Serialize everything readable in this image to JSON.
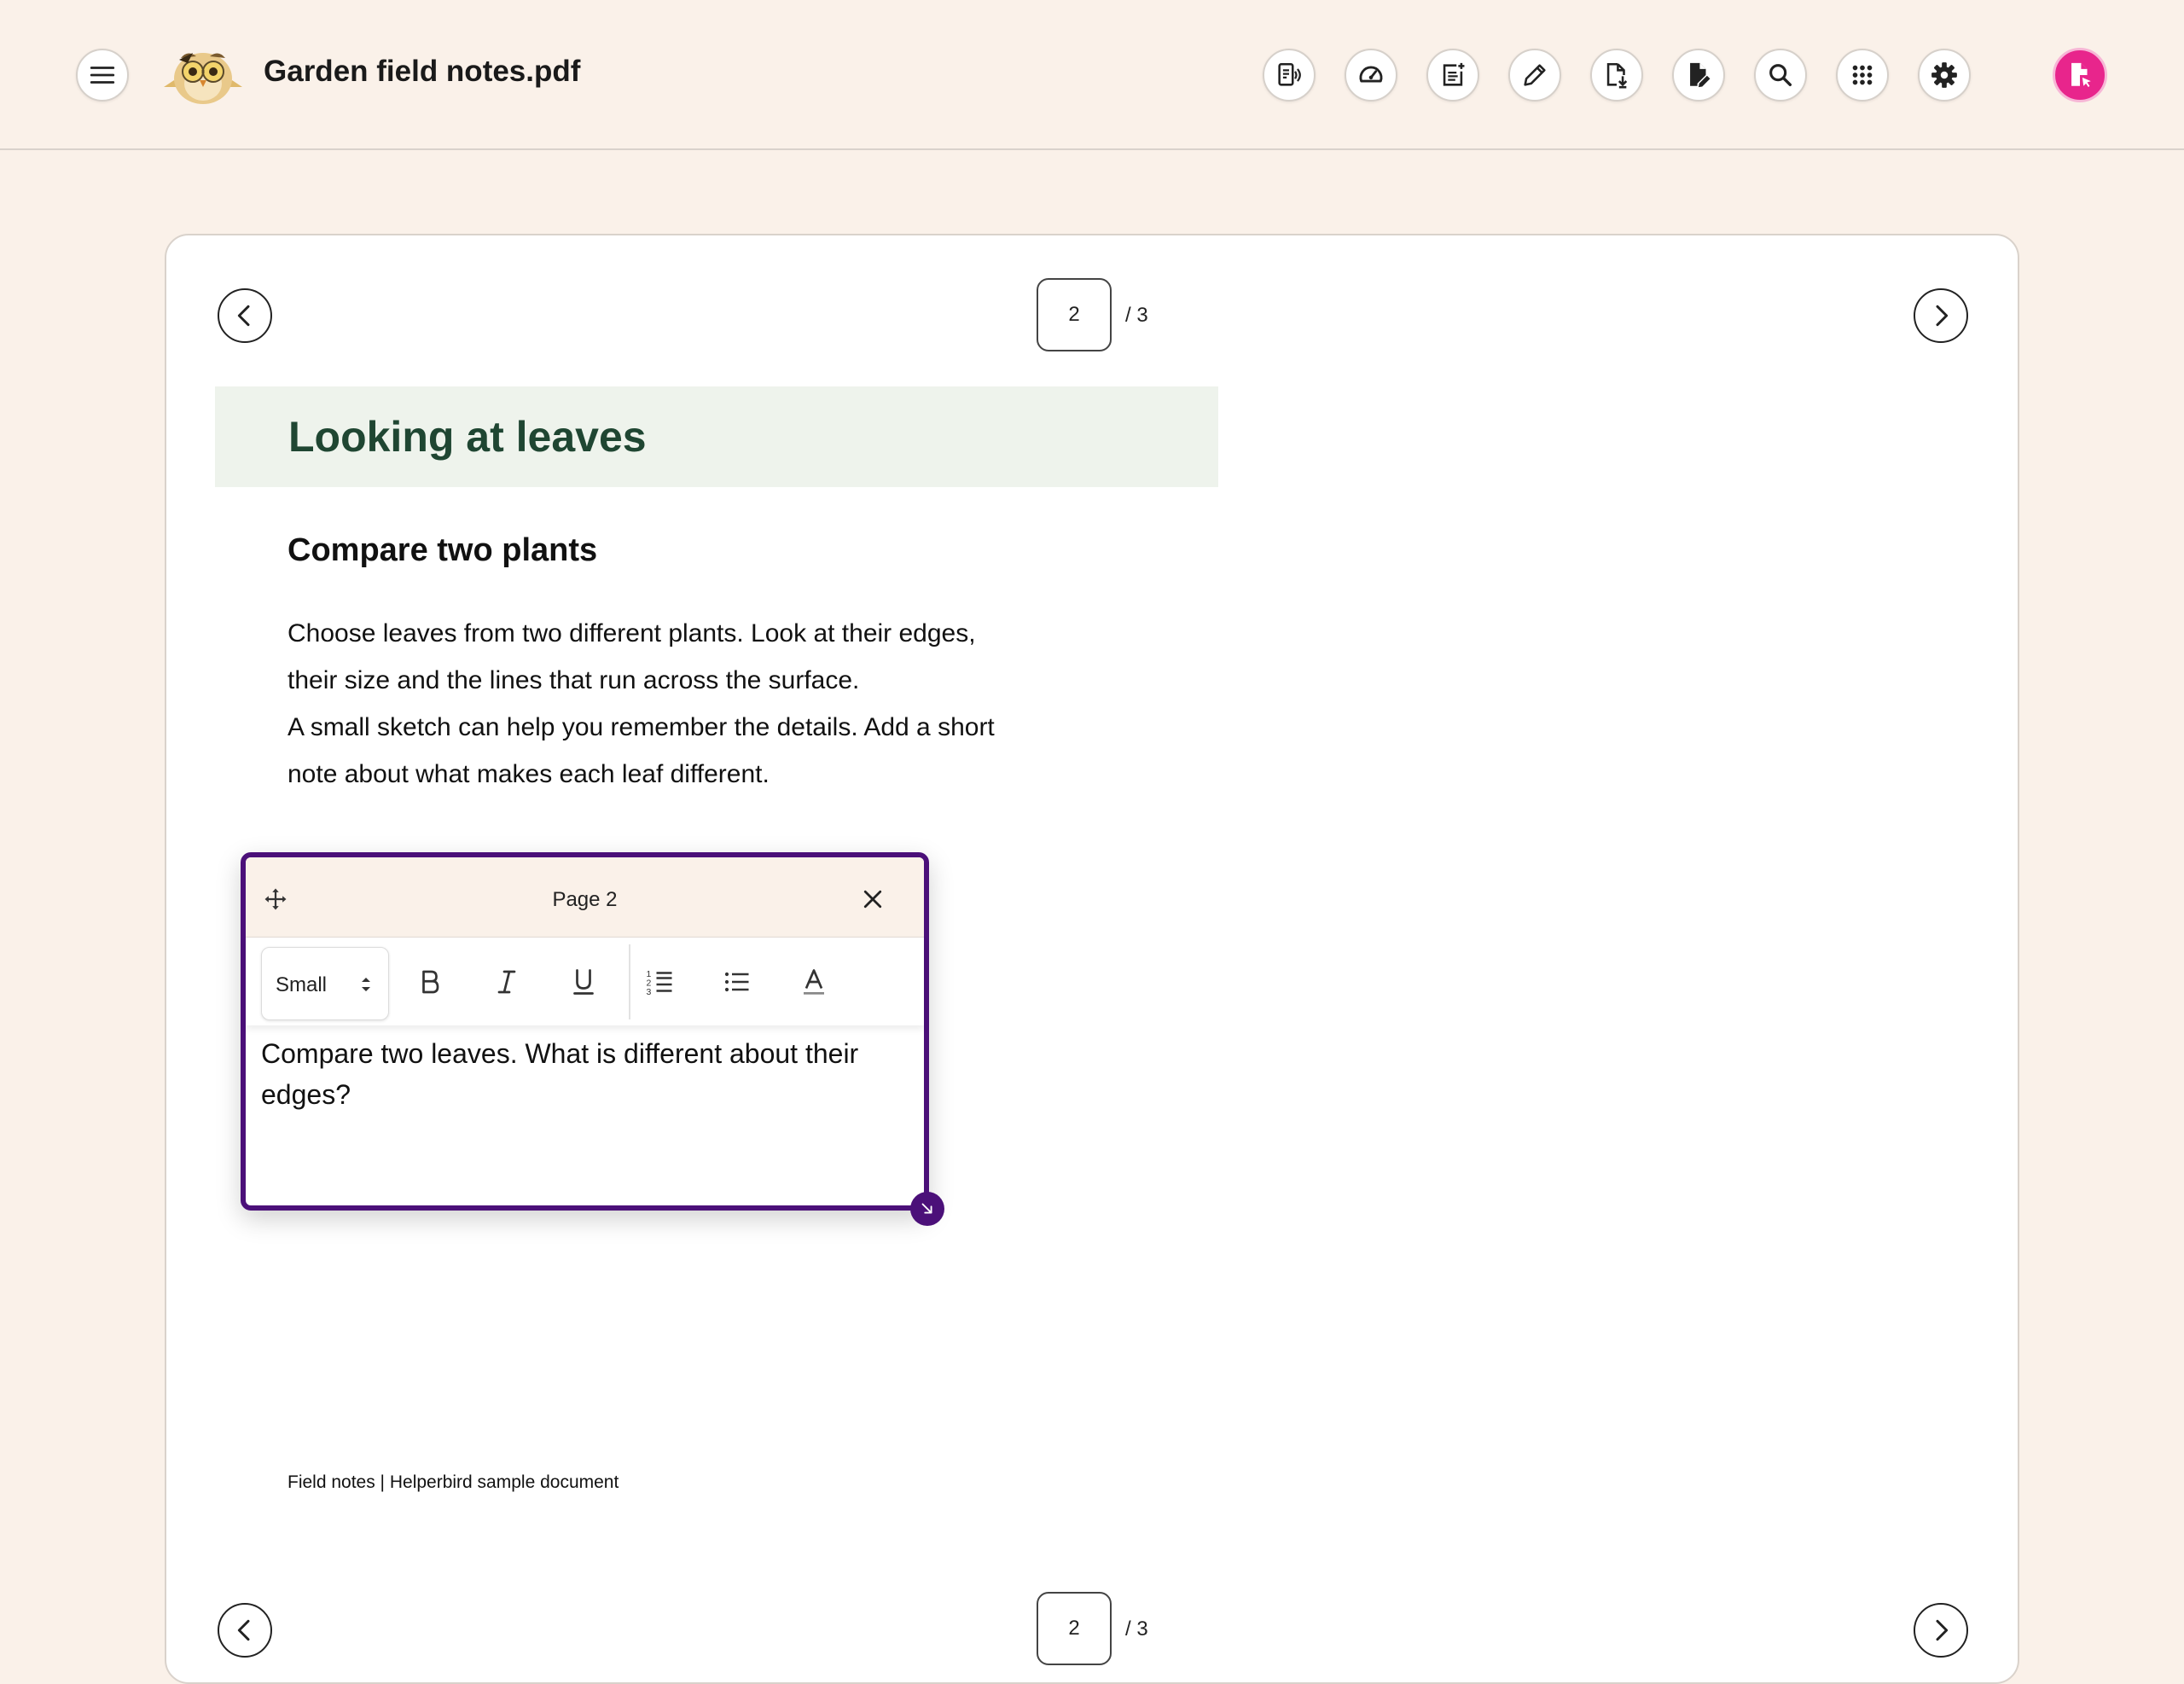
{
  "app": {
    "document_title": "Garden field notes.pdf",
    "logo_name": "helperbird-owl-logo"
  },
  "toolbar": {
    "buttons": [
      {
        "name": "read-aloud",
        "icon": "read-aloud-icon"
      },
      {
        "name": "reading-speed",
        "icon": "speedometer-icon"
      },
      {
        "name": "add-note",
        "icon": "note-add-icon"
      },
      {
        "name": "draw",
        "icon": "pencil-icon"
      },
      {
        "name": "download",
        "icon": "file-download-icon"
      },
      {
        "name": "edit-file",
        "icon": "file-edit-icon"
      },
      {
        "name": "search",
        "icon": "search-icon"
      },
      {
        "name": "apps",
        "icon": "apps-grid-icon"
      },
      {
        "name": "settings",
        "icon": "gear-icon"
      }
    ],
    "profile_icon": "file-cursor-icon",
    "profile_color": "#E8258C"
  },
  "pager_top": {
    "current_page": "2",
    "total": "/ 3"
  },
  "pager_bottom": {
    "current_page": "2",
    "total": "/ 3"
  },
  "document": {
    "heading": "Looking at leaves",
    "subheading": "Compare two plants",
    "paragraph_lines": [
      "Choose leaves from two different plants. Look at their edges,",
      "their size and the lines that run across the surface.",
      "A small sketch can help you remember the details. Add a short",
      "note about what makes each leaf different."
    ],
    "footer": "Field notes | Helperbird sample document"
  },
  "note_popup": {
    "title": "Page 2",
    "font_size": "Small",
    "tools": [
      "bold-icon",
      "italic-icon",
      "underline-icon",
      "numbered-list-icon",
      "bullet-list-icon",
      "text-color-icon"
    ],
    "text": "Compare two leaves. What is different about their edges?",
    "border_color": "#4B1079"
  },
  "colors": {
    "background": "#FAF1E9",
    "heading_band": "#EEF3EC",
    "heading_text": "#1F4632",
    "note_accent": "#4B1079",
    "profile_accent": "#E8258C"
  }
}
